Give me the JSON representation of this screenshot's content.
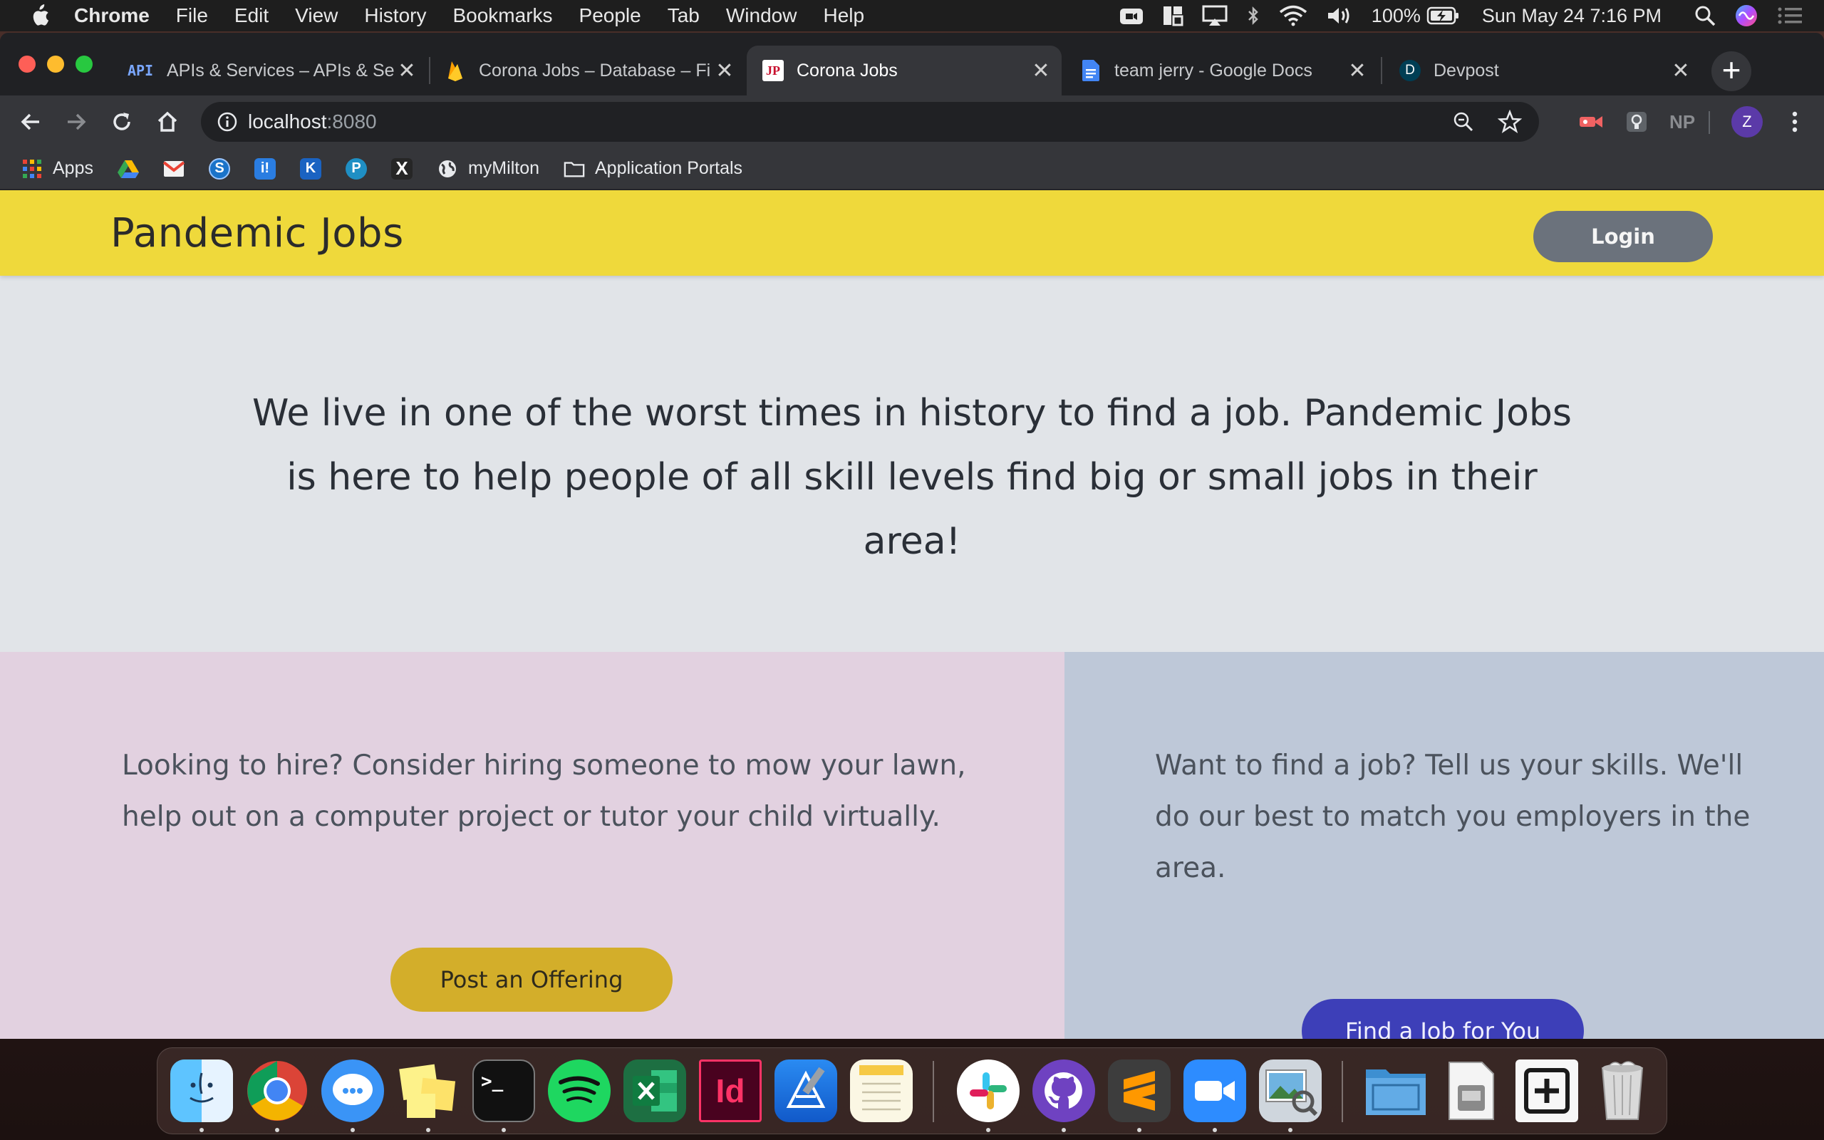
{
  "menubar": {
    "app": "Chrome",
    "menus": [
      "File",
      "Edit",
      "View",
      "History",
      "Bookmarks",
      "People",
      "Tab",
      "Window",
      "Help"
    ],
    "battery": "100%",
    "datetime": "Sun May 24  7:16 PM"
  },
  "tabs": [
    {
      "title": "APIs & Services – APIs & Se",
      "favicon": "API"
    },
    {
      "title": "Corona Jobs – Database – Fi",
      "favicon": "firebase-icon"
    },
    {
      "title": "Corona Jobs",
      "favicon": "JP",
      "active": true
    },
    {
      "title": "team jerry - Google Docs",
      "favicon": "docs-icon"
    },
    {
      "title": "Devpost",
      "favicon": "D"
    }
  ],
  "address": {
    "host": "localhost",
    "port": ":8080"
  },
  "bookmarks": {
    "apps": "Apps",
    "my_milton": "myMilton",
    "app_portals": "Application Portals"
  },
  "page": {
    "brand": "Pandemic Jobs",
    "login": "Login",
    "hero": "We live in one of the worst times in history to find a job. Pandemic Jobs is here to help people of all skill levels find big or small jobs in their area!",
    "hire_text": "Looking to hire? Consider hiring someone to mow your lawn, help out on a computer project or tutor your child virtually.",
    "hire_button": "Post an Offering",
    "seek_text": "Want to find a job? Tell us your skills. We'll do our best to match you employers in the area.",
    "seek_button": "Find a Job for You"
  },
  "colors": {
    "navbar": "#efd93b",
    "post_button": "#d3ae2a",
    "find_button": "#3d3fb8"
  }
}
